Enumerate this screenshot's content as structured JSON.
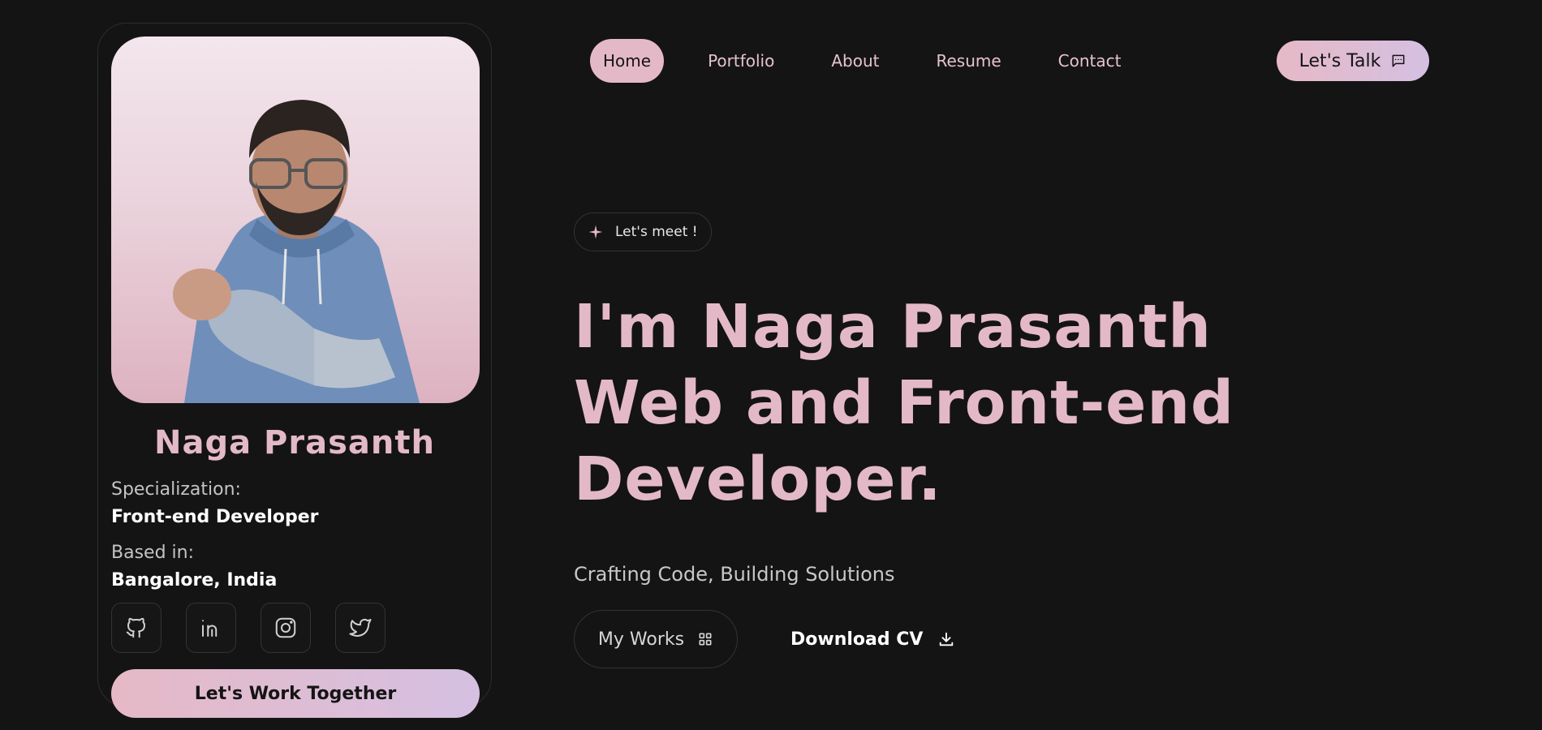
{
  "profile": {
    "name": "Naga Prasanth",
    "photo_alt": "Profile photo",
    "specialization_label": "Specialization:",
    "specialization_value": "Front-end Developer",
    "based_label": "Based in:",
    "based_value": "Bangalore, India",
    "socials": [
      "github-icon",
      "linkedin-icon",
      "instagram-icon",
      "twitter-icon"
    ],
    "cta_label": "Let's Work Together"
  },
  "nav": {
    "items": [
      {
        "label": "Home",
        "active": true
      },
      {
        "label": "Portfolio",
        "active": false
      },
      {
        "label": "About",
        "active": false
      },
      {
        "label": "Resume",
        "active": false
      },
      {
        "label": "Contact",
        "active": false
      }
    ],
    "talk_label": "Let's Talk",
    "talk_icon": "chat-icon"
  },
  "hero": {
    "badge_label": "Let's meet !",
    "badge_icon": "sparkle-icon",
    "title_lines": [
      "I'm Naga Prasanth",
      "Web and Front-end",
      "Developer."
    ],
    "tagline": "Crafting Code, Building Solutions",
    "works_label": "My Works",
    "works_icon": "grid-icon",
    "cv_label": "Download CV",
    "cv_icon": "download-icon"
  },
  "colors": {
    "background": "#141414",
    "accent_pink": "#e4b9c7",
    "accent_lavender": "#d5c0e2",
    "text_white": "#ffffff"
  }
}
